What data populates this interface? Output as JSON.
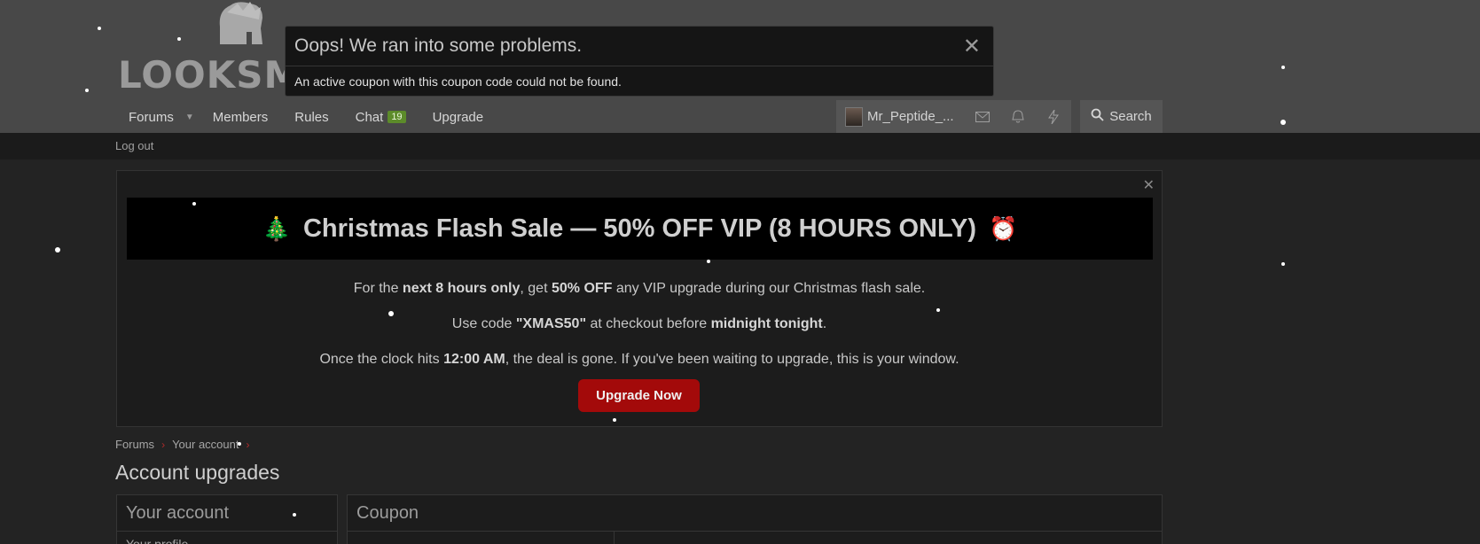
{
  "header": {
    "logo_text": "LOOKSMAX"
  },
  "nav": {
    "forums": "Forums",
    "members": "Members",
    "rules": "Rules",
    "chat": "Chat",
    "chat_badge": "19",
    "upgrade": "Upgrade"
  },
  "user": {
    "name": "Mr_Peptide_..."
  },
  "search": {
    "label": "Search"
  },
  "subnav": {
    "logout": "Log out"
  },
  "notice": {
    "title": "Christmas Flash Sale — 50% OFF VIP (8 HOURS ONLY)",
    "line1": {
      "pre": "For the ",
      "b1": "next 8 hours only",
      "mid": ", get ",
      "b2": "50% OFF",
      "post": " any VIP upgrade during our Christmas flash sale."
    },
    "line2": {
      "pre": "Use code ",
      "b1": "\"XMAS50\"",
      "mid": " at checkout before ",
      "b2": "midnight tonight",
      "post": "."
    },
    "line3": {
      "pre": "Once the clock hits ",
      "b1": "12:00 AM",
      "post": ", the deal is gone. If you've been waiting to upgrade, this is your window."
    },
    "button": "Upgrade Now"
  },
  "breadcrumb": [
    "Forums",
    "Your account"
  ],
  "page": {
    "title": "Account upgrades"
  },
  "sidebar": {
    "title": "Your account",
    "first_item": "Your profile"
  },
  "main": {
    "title": "Coupon"
  },
  "error_overlay": {
    "title": "Oops! We ran into some problems.",
    "message": "An active coupon with this coupon code could not be found."
  },
  "colors": {
    "accent_red": "#a30a0a",
    "badge_green": "#5c8b2a",
    "header_bg": "#484848"
  }
}
